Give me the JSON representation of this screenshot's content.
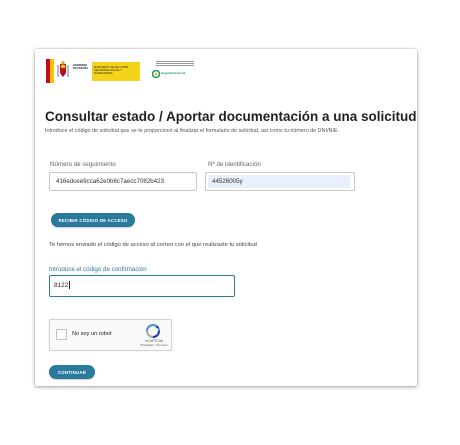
{
  "header": {
    "gob_label": "GOBIERNO DE ESPAÑA",
    "ministry_label": "MINISTERIO DE INCLUSIÓN, SEGURIDAD SOCIAL Y MIGRACIONES",
    "seg_social_label": "Seguridad Social"
  },
  "page": {
    "title": "Consultar estado / Aportar documentación a una solicitud",
    "description": "Introduce el código de solicitud que se te proporcionó al finalizar el formulario de solicitud, así como tu número de DNI/NIE."
  },
  "form": {
    "tracking_label": "Número de seguimiento",
    "tracking_value": "416edcee9cca62e0b6c7aecc7082b423",
    "id_label": "Nº de identificación",
    "id_value": "44526005y",
    "receive_code_button": "RECIBIR CÓDIGO DE ACCESO",
    "sent_message": "Te hemos enviado el código de acceso al correo con el que realizaste tu solicitud",
    "code_label": "Introduce el código de confirmación",
    "code_value": "8122",
    "recaptcha_label": "No soy un robot",
    "recaptcha_brand": "reCAPTCHA",
    "recaptcha_links": "Privacidad - Términos",
    "continue_button": "CONTINUAR"
  },
  "colors": {
    "accent": "#2a7a9e",
    "autofill": "#e8f0fe",
    "title": "#222222"
  }
}
